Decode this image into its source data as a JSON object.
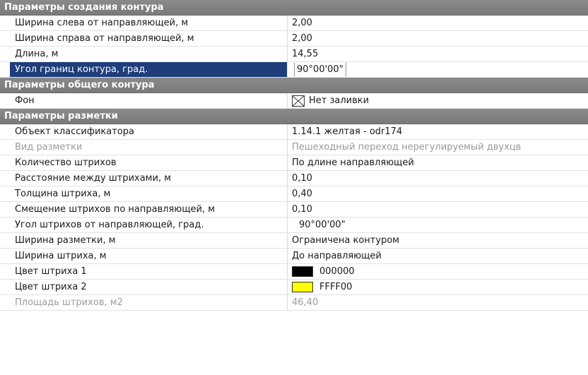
{
  "sections": {
    "contour_creation": "Параметры создания контура",
    "general_contour": "Параметры общего контура",
    "marking": "Параметры разметки"
  },
  "contour_creation": {
    "width_left": {
      "label": "Ширина слева от направляющей, м",
      "value": "2,00"
    },
    "width_right": {
      "label": "Ширина справа от направляющей, м",
      "value": "2,00"
    },
    "length": {
      "label": "Длина, м",
      "value": "14,55"
    },
    "angle": {
      "label": "Угол границ контура, град.",
      "value": "90°00'00\""
    }
  },
  "general_contour": {
    "background": {
      "label": "Фон",
      "value": "Нет заливки"
    }
  },
  "marking": {
    "classifier": {
      "label": "Объект классификатора",
      "value": "1.14.1 желтая - odr174"
    },
    "marking_type": {
      "label": "Вид разметки",
      "value": "Пешеходный переход нерегулируемый двухцв"
    },
    "stroke_count": {
      "label": "Количество штрихов",
      "value": "По длине направляющей"
    },
    "stroke_spacing": {
      "label": "Расстояние между штрихами, м",
      "value": "0,10"
    },
    "stroke_thickness": {
      "label": "Толщина штриха, м",
      "value": "0,40"
    },
    "stroke_offset": {
      "label": "Смещение штрихов по направляющей, м",
      "value": "0,10"
    },
    "stroke_angle": {
      "label": "Угол штрихов от направляющей, град.",
      "value": "90°00'00\""
    },
    "marking_width": {
      "label": "Ширина разметки, м",
      "value": "Ограничена контуром"
    },
    "stroke_width": {
      "label": "Ширина штриха, м",
      "value": "До направляющей"
    },
    "stroke_color_1": {
      "label": "Цвет штриха 1",
      "value": "000000",
      "color": "#000000"
    },
    "stroke_color_2": {
      "label": "Цвет штриха 2",
      "value": "FFFF00",
      "color": "#FFFF00"
    },
    "stroke_area": {
      "label": "Площадь штрихов, м2",
      "value": "46,40"
    }
  },
  "icons": {
    "no_fill": "no-fill-icon"
  },
  "colors": {
    "section_bg": "#808080",
    "selected_bg": "#1e3d7a"
  }
}
